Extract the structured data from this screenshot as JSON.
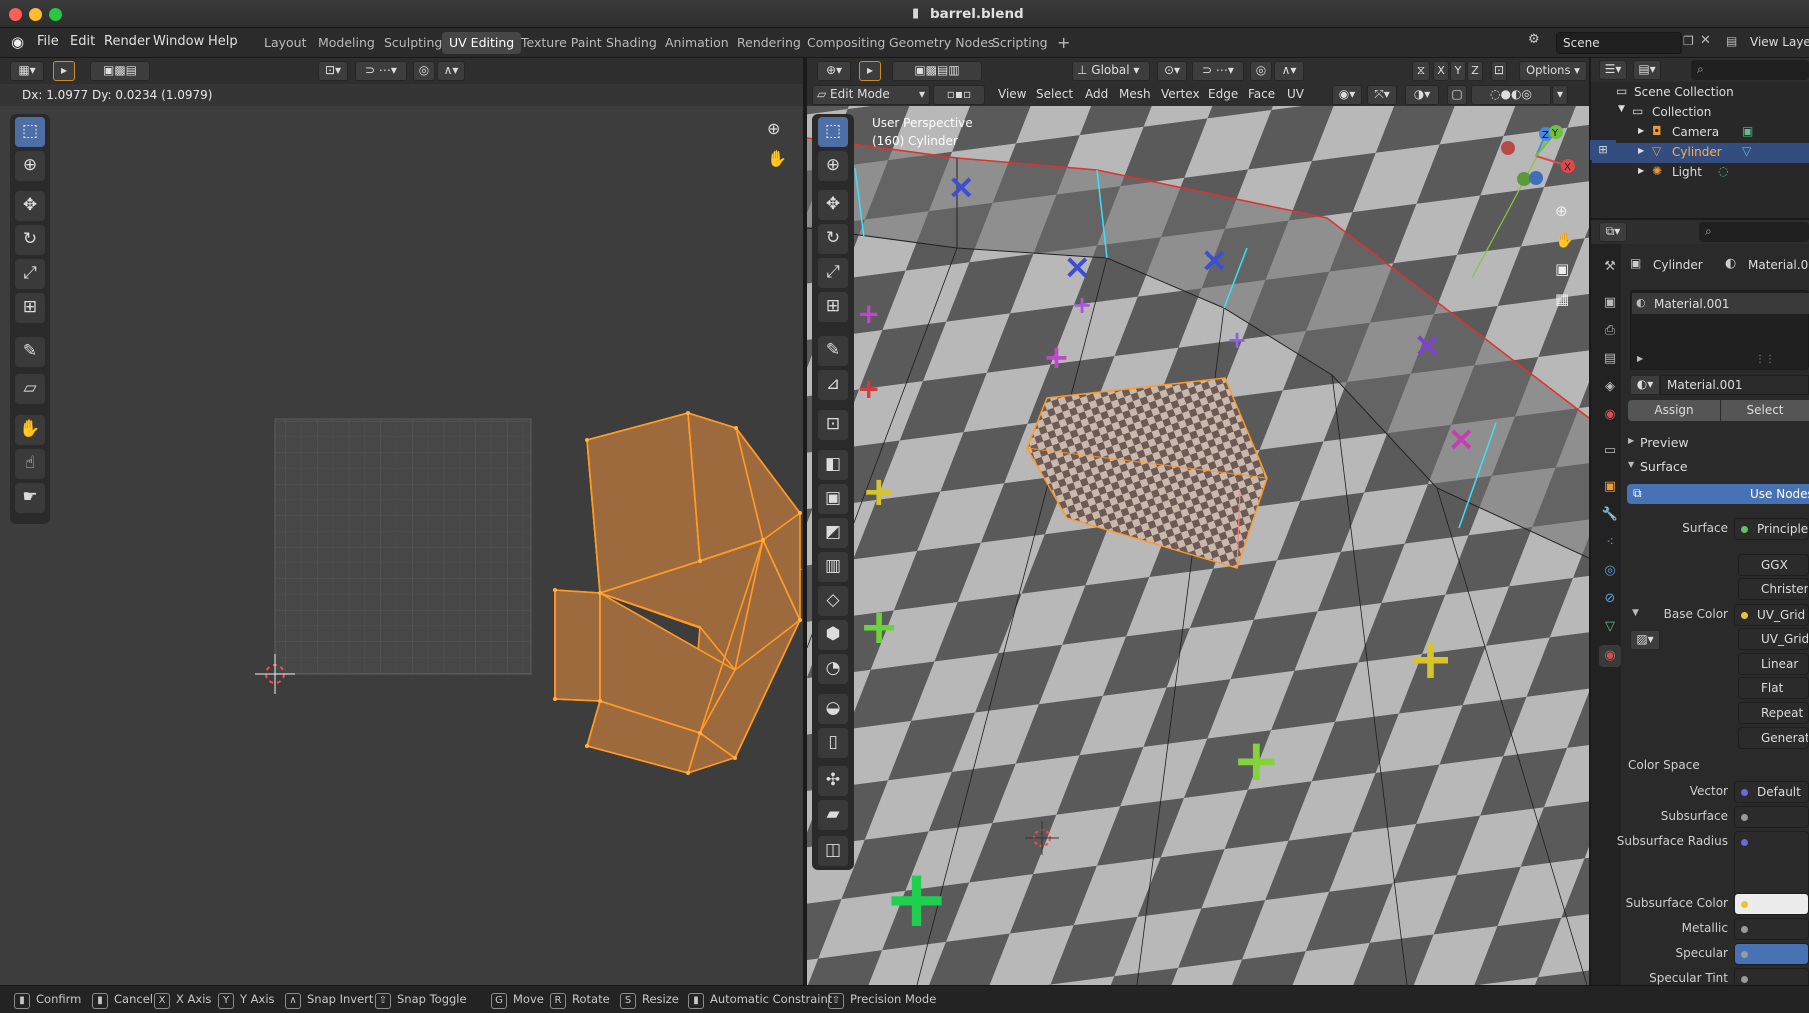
{
  "window": {
    "title": "barrel.blend"
  },
  "menu": [
    "File",
    "Edit",
    "Render",
    "Window",
    "Help"
  ],
  "workspaces": [
    "Layout",
    "Modeling",
    "Sculpting",
    "UV Editing",
    "Texture Paint",
    "Shading",
    "Animation",
    "Rendering",
    "Compositing",
    "Geometry Nodes",
    "Scripting"
  ],
  "active_workspace": "UV Editing",
  "scene": {
    "label": "Scene",
    "view_layer": "View Laye"
  },
  "uv_editor": {
    "transform_readout": "Dx: 1.0977   Dy: 0.0234 (1.0979)"
  },
  "viewport": {
    "mode": "Edit Mode",
    "orientation": "Global",
    "options_label": "Options",
    "menus": [
      "View",
      "Select",
      "Add",
      "Mesh",
      "Vertex",
      "Edge",
      "Face",
      "UV"
    ],
    "overlay_title": "User Perspective",
    "overlay_object": "(160) Cylinder",
    "axes": [
      "X",
      "Y",
      "Z"
    ]
  },
  "outliner": {
    "collection_root": "Scene Collection",
    "collection": "Collection",
    "items": [
      {
        "name": "Camera",
        "icon": "camera-icon"
      },
      {
        "name": "Cylinder",
        "icon": "mesh-icon",
        "selected": true
      },
      {
        "name": "Light",
        "icon": "light-icon"
      }
    ]
  },
  "properties": {
    "object_name": "Cylinder",
    "material_name": "Material.001",
    "slot_name": "Material.001",
    "material_field": "Material.001",
    "assign_label": "Assign",
    "select_label": "Select",
    "panels": {
      "preview": "Preview",
      "surface": "Surface"
    },
    "use_nodes": "Use Nodes",
    "rows": [
      {
        "label": "Surface",
        "value": "Principled",
        "dot": "#5fc35f"
      },
      {
        "label": "",
        "value": "GGX",
        "dot": ""
      },
      {
        "label": "",
        "value": "Christensen-",
        "dot": ""
      },
      {
        "label": "Base Color",
        "value": "UV_Grid",
        "dot": "#e6c53b"
      },
      {
        "label": "",
        "value": "UV_Grid",
        "dot": ""
      },
      {
        "label": "",
        "value": "Linear",
        "dot": ""
      },
      {
        "label": "",
        "value": "Flat",
        "dot": ""
      },
      {
        "label": "",
        "value": "Repeat",
        "dot": ""
      },
      {
        "label": "",
        "value": "Generated",
        "dot": ""
      },
      {
        "label": "Color Space",
        "value": "",
        "dot": ""
      },
      {
        "label": "Vector",
        "value": "Default",
        "dot": "#6a6ad8"
      },
      {
        "label": "Subsurface",
        "value": "",
        "dot": "#9a9a9a"
      },
      {
        "label": "Subsurface Radius",
        "value": "",
        "dot": "#6a6ad8"
      },
      {
        "label": "Subsurface Color",
        "value": "",
        "dot": "#e6c53b"
      },
      {
        "label": "Metallic",
        "value": "",
        "dot": "#9a9a9a"
      },
      {
        "label": "Specular",
        "value": "",
        "dot": "#9a9a9a"
      },
      {
        "label": "Specular Tint",
        "value": "",
        "dot": "#9a9a9a"
      }
    ]
  },
  "status_bar": [
    {
      "key": "▮",
      "label": "Confirm"
    },
    {
      "key": "▮",
      "label": "Cancel"
    },
    {
      "key": "X",
      "label": "X Axis"
    },
    {
      "key": "Y",
      "label": "Y Axis"
    },
    {
      "key": "∧",
      "label": "Snap Invert"
    },
    {
      "key": "⇧",
      "label": "Snap Toggle"
    },
    {
      "key": "G",
      "label": "Move"
    },
    {
      "key": "R",
      "label": "Rotate"
    },
    {
      "key": "S",
      "label": "Resize"
    },
    {
      "key": "▮",
      "label": "Automatic Constraint"
    },
    {
      "key": "⇧",
      "label": "Precision Mode"
    }
  ],
  "colors": {
    "accent": "#4772b3",
    "selection": "#ffa033",
    "uv_face": "#9c6a3c",
    "background": "#3d3d3d"
  }
}
